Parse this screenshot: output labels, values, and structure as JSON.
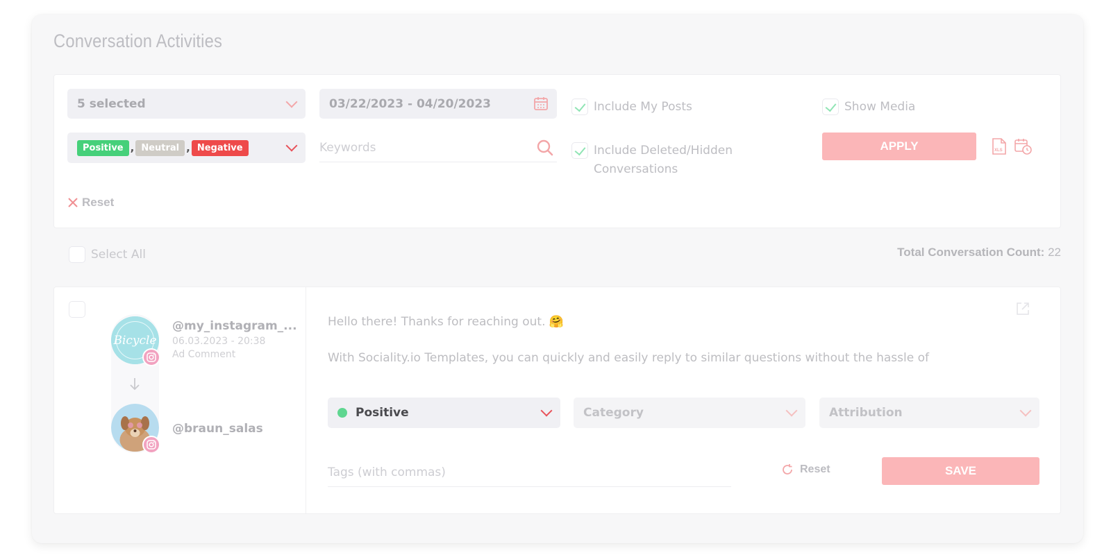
{
  "page": {
    "title": "Conversation Activities"
  },
  "filters": {
    "account_select": {
      "value": "5 selected"
    },
    "date_range": {
      "value": "03/22/2023 - 04/20/2023"
    },
    "sentiment_chips": [
      "Positive",
      "Neutral",
      "Negative"
    ],
    "chip_separator": ",",
    "keywords": {
      "placeholder": "Keywords"
    },
    "include_my_posts": {
      "label": "Include My Posts",
      "checked": true
    },
    "show_media": {
      "label": "Show Media",
      "checked": true
    },
    "include_deleted": {
      "label_line1": "Include Deleted/Hidden",
      "label_line2": "Conversations",
      "checked": true
    },
    "apply_label": "APPLY",
    "reset_label": "Reset"
  },
  "list": {
    "select_all_label": "Select All",
    "total_label": "Total Conversation Count:",
    "total_value": "22"
  },
  "conversation": {
    "from": {
      "handle": "@my_instagram_...",
      "datetime": "06.03.2023 - 20:38",
      "type": "Ad Comment",
      "avatar_text": "Bicycle"
    },
    "to": {
      "handle": "@braun_salas"
    },
    "message_line1": "Hello there! Thanks for reaching out. 🤗",
    "message_line2": "With Sociality.io Templates, you can quickly and easily reply to similar questions without the hassle of",
    "sentiment": "Positive",
    "category_placeholder": "Category",
    "attribution_placeholder": "Attribution",
    "tags_placeholder": "Tags (with commas)",
    "reset_label": "Reset",
    "save_label": "SAVE"
  },
  "colors": {
    "accent": "#fbb6b8",
    "accent_strong": "#e8525a",
    "positive": "#46d07a",
    "neutral": "#cfccc6",
    "negative": "#ee4a4a",
    "check": "#8fe4b4"
  },
  "icons": [
    "chevron-down-icon",
    "calendar-icon",
    "search-icon",
    "xls-file-icon",
    "scheduled-report-icon",
    "close-icon",
    "external-link-icon",
    "arrow-down-icon",
    "instagram-icon",
    "refresh-icon"
  ]
}
